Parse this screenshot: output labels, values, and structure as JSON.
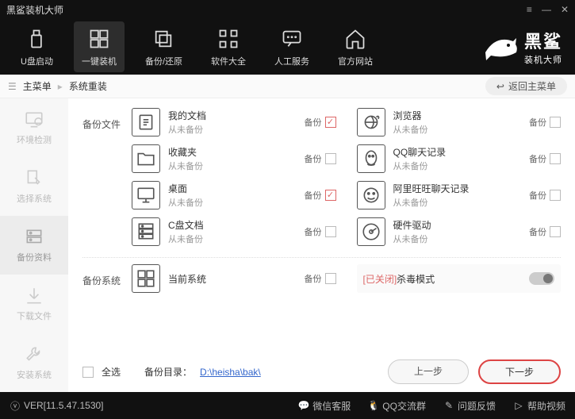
{
  "title": "黑鲨装机大师",
  "brand": {
    "big": "黑鲨",
    "small": "装机大师"
  },
  "nav": [
    {
      "id": "usb",
      "label": "U盘启动"
    },
    {
      "id": "onekey",
      "label": "一键装机"
    },
    {
      "id": "backup",
      "label": "备份/还原"
    },
    {
      "id": "software",
      "label": "软件大全"
    },
    {
      "id": "service",
      "label": "人工服务"
    },
    {
      "id": "site",
      "label": "官方网站"
    }
  ],
  "crumb": {
    "root": "主菜单",
    "current": "系统重装",
    "return": "返回主菜单"
  },
  "sidebar": [
    {
      "id": "env",
      "label": "环境检测"
    },
    {
      "id": "sys",
      "label": "选择系统"
    },
    {
      "id": "data",
      "label": "备份资料"
    },
    {
      "id": "dl",
      "label": "下载文件"
    },
    {
      "id": "install",
      "label": "安装系统"
    }
  ],
  "sections": {
    "files": {
      "label": "备份文件",
      "items": [
        {
          "name": "我的文档",
          "sub": "从未备份",
          "chk": "备份",
          "checked": true,
          "icon": "doc"
        },
        {
          "name": "浏览器",
          "sub": "从未备份",
          "chk": "备份",
          "checked": false,
          "icon": "ie"
        },
        {
          "name": "收藏夹",
          "sub": "从未备份",
          "chk": "备份",
          "checked": false,
          "icon": "folder"
        },
        {
          "name": "QQ聊天记录",
          "sub": "从未备份",
          "chk": "备份",
          "checked": false,
          "icon": "qq"
        },
        {
          "name": "桌面",
          "sub": "从未备份",
          "chk": "备份",
          "checked": true,
          "icon": "desktop"
        },
        {
          "name": "阿里旺旺聊天记录",
          "sub": "从未备份",
          "chk": "备份",
          "checked": false,
          "icon": "ww"
        },
        {
          "name": "C盘文档",
          "sub": "从未备份",
          "chk": "备份",
          "checked": false,
          "icon": "server"
        },
        {
          "name": "硬件驱动",
          "sub": "从未备份",
          "chk": "备份",
          "checked": false,
          "icon": "hdd"
        }
      ]
    },
    "system": {
      "label": "备份系统",
      "items": [
        {
          "name": "当前系统",
          "sub": "",
          "chk": "备份",
          "checked": false,
          "icon": "win"
        }
      ],
      "kill": {
        "prefix": "[已关闭]",
        "label": " 杀毒模式"
      }
    }
  },
  "footer": {
    "selectall": "全选",
    "dirlabel": "备份目录：",
    "dirpath": "D:\\heisha\\bak\\",
    "prev": "上一步",
    "next": "下一步"
  },
  "status": {
    "ver": "VER[11.5.47.1530]",
    "wx": "微信客服",
    "qq": "QQ交流群",
    "fb": "问题反馈",
    "help": "帮助视频"
  }
}
